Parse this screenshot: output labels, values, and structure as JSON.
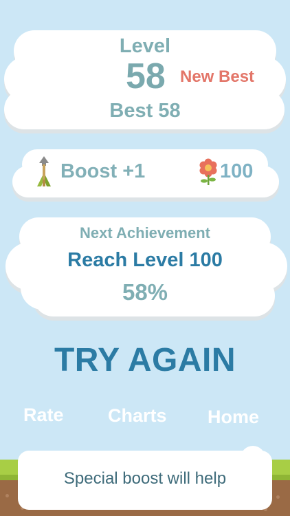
{
  "score": {
    "level_label": "Level",
    "current_level": "58",
    "new_best_label": "New Best",
    "best_text": "Best 58"
  },
  "boost": {
    "arrow_icon": "arrow-icon",
    "label": "Boost +1",
    "flower_icon": "flower-icon",
    "coins": "100"
  },
  "achievement": {
    "title": "Next Achievement",
    "goal": "Reach Level 100",
    "progress": "58%"
  },
  "try_again_label": "TRY AGAIN",
  "menu": {
    "rate": "Rate",
    "charts": "Charts",
    "home": "Home"
  },
  "toast": {
    "message": "Special boost will help"
  },
  "colors": {
    "sky": "#cce7f6",
    "accent_blue": "#2b7ba4",
    "muted_teal": "#7faeb3",
    "new_best_red": "#e37669",
    "grass": "#a8ce45",
    "dirt": "#9a6a45"
  }
}
